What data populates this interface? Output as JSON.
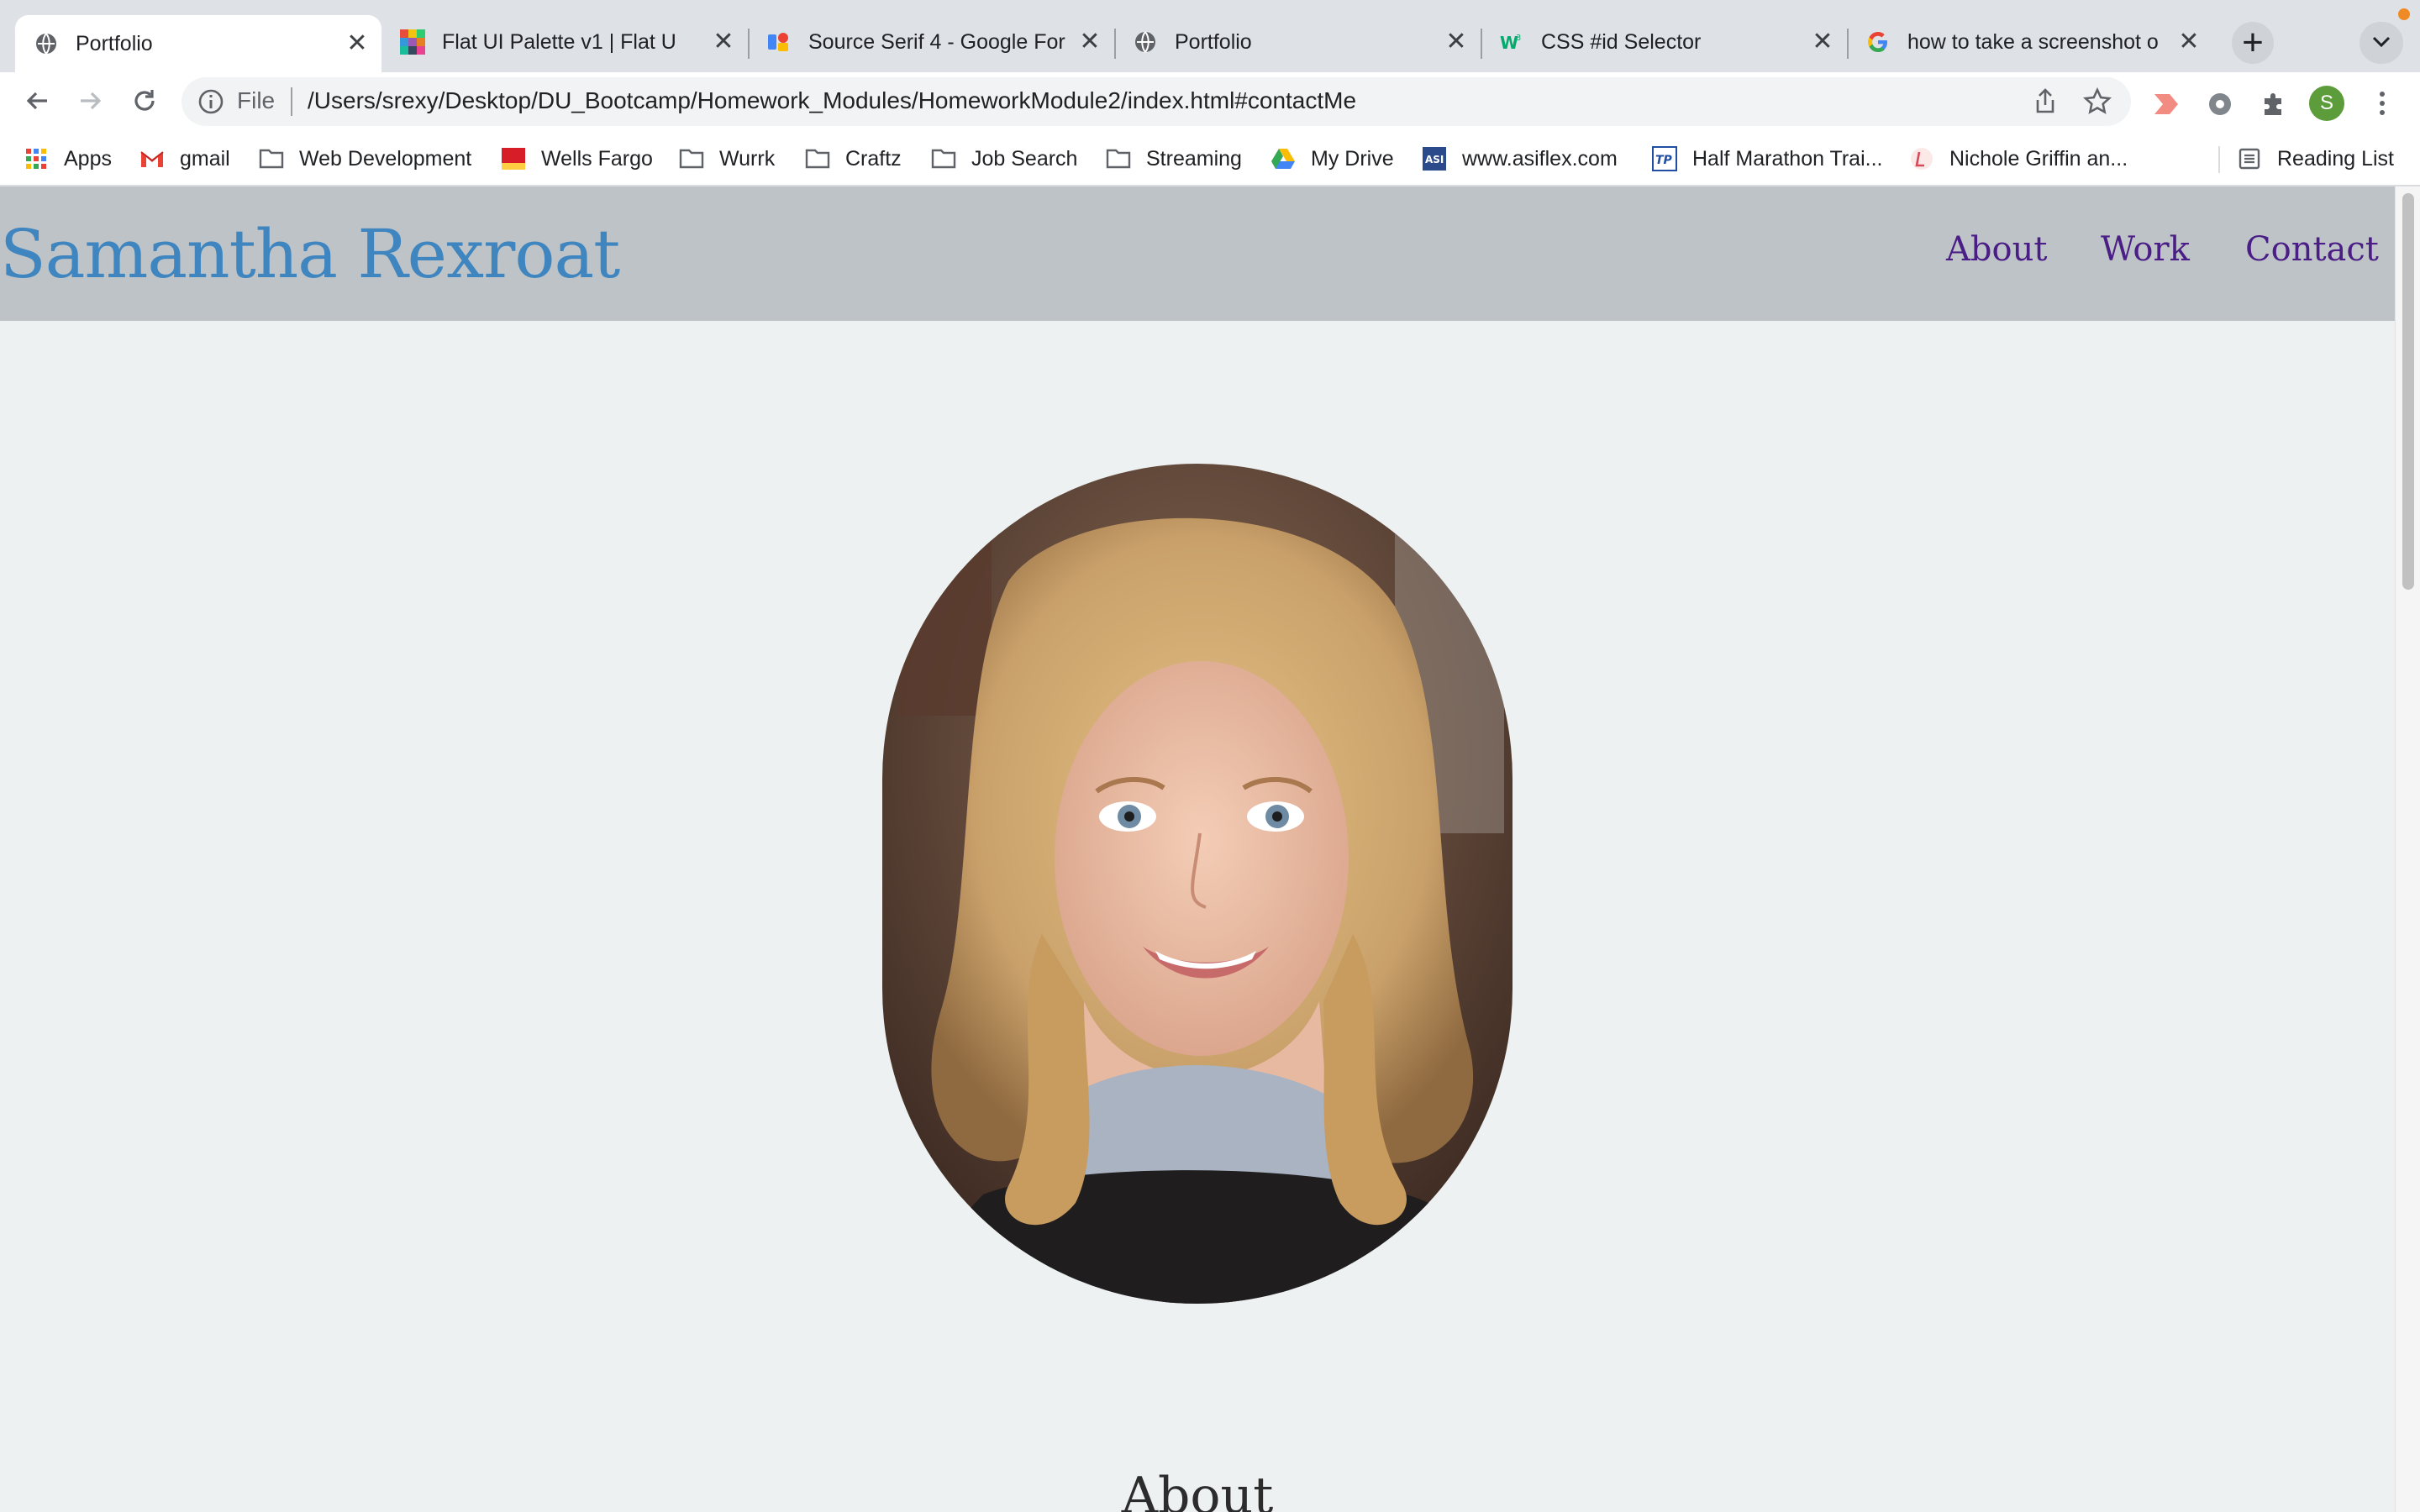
{
  "browser": {
    "tabs": [
      {
        "title": "Portfolio",
        "favicon": "globe-icon",
        "active": true
      },
      {
        "title": "Flat UI Palette v1 | Flat U",
        "favicon": "palette-icon",
        "active": false
      },
      {
        "title": "Source Serif 4 - Google For",
        "favicon": "google-fonts-icon",
        "active": false
      },
      {
        "title": "Portfolio",
        "favicon": "globe-icon",
        "active": false
      },
      {
        "title": "CSS #id Selector",
        "favicon": "w3schools-icon",
        "active": false
      },
      {
        "title": "how to take a screenshot o",
        "favicon": "google-icon",
        "active": false
      }
    ],
    "new_tab_symbol": "+",
    "close_symbol": "✕",
    "omnibox": {
      "scheme_label": "File",
      "url": "/Users/srexy/Desktop/DU_Bootcamp/Homework_Modules/HomeworkModule2/index.html#contactMe"
    },
    "profile_initial": "S",
    "bookmarks": [
      {
        "label": "Apps",
        "icon": "apps-grid-icon"
      },
      {
        "label": "gmail",
        "icon": "gmail-icon"
      },
      {
        "label": "Web Development",
        "icon": "folder-icon"
      },
      {
        "label": "Wells Fargo",
        "icon": "wells-fargo-icon"
      },
      {
        "label": "Wurrk",
        "icon": "folder-icon"
      },
      {
        "label": "Craftz",
        "icon": "folder-icon"
      },
      {
        "label": "Job Search",
        "icon": "folder-icon"
      },
      {
        "label": "Streaming",
        "icon": "folder-icon"
      },
      {
        "label": "My Drive",
        "icon": "google-drive-icon"
      },
      {
        "label": "www.asiflex.com",
        "icon": "asiflex-icon"
      },
      {
        "label": "Half Marathon Trai...",
        "icon": "tp-icon"
      },
      {
        "label": "Nichole Griffin an...",
        "icon": "site-icon"
      }
    ],
    "reading_list_label": "Reading List"
  },
  "site": {
    "name": "Samantha Rexroat",
    "nav": [
      "About",
      "Work",
      "Contact"
    ],
    "about_heading": "About"
  },
  "colors": {
    "page_background": "#eef1f2",
    "header_background": "#bdc3c7",
    "site_name": "#3f85bf",
    "nav_link": "#4b1e86"
  }
}
